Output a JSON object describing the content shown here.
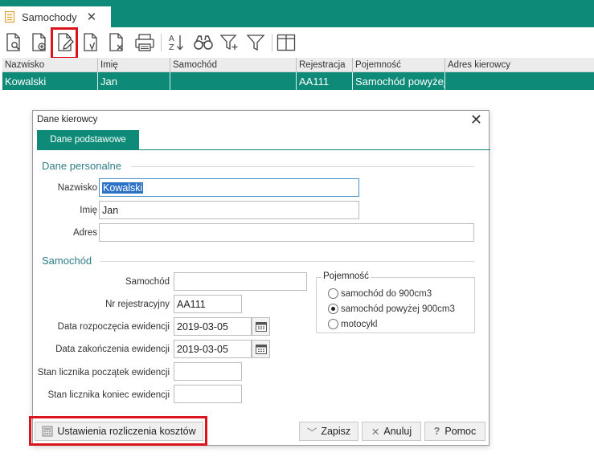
{
  "tab": {
    "title": "Samochody",
    "icon": "document-list-icon",
    "close_glyph": "✕"
  },
  "toolbar": {
    "buttons": [
      {
        "name": "preview-document-icon"
      },
      {
        "name": "add-document-icon"
      },
      {
        "name": "edit-document-icon",
        "highlighted": true
      },
      {
        "name": "approve-document-icon"
      },
      {
        "name": "delete-document-icon"
      },
      {
        "name": "print-icon"
      },
      {
        "name": "sort-az-icon"
      },
      {
        "name": "binoculars-icon"
      },
      {
        "name": "filter-add-icon"
      },
      {
        "name": "filter-icon"
      },
      {
        "name": "columns-icon"
      }
    ]
  },
  "grid": {
    "columns": [
      "Nazwisko",
      "Imię",
      "Samochód",
      "Rejestracja",
      "Pojemność",
      "Adres kierowcy"
    ],
    "rows": [
      [
        "Kowalski",
        "Jan",
        "",
        "AA111",
        "Samochód powyżej",
        ""
      ]
    ]
  },
  "dialog": {
    "title": "Dane kierowcy",
    "close_glyph": "✕",
    "tab_label": "Dane podstawowe",
    "personal": {
      "section_title": "Dane personalne",
      "surname_label": "Nazwisko",
      "surname_value": "Kowalski",
      "name_label": "Imię",
      "name_value": "Jan",
      "address_label": "Adres",
      "address_value": ""
    },
    "car": {
      "section_title": "Samochód",
      "car_label": "Samochód",
      "car_value": "",
      "reg_label": "Nr rejestracyjny",
      "reg_value": "AA111",
      "start_date_label": "Data rozpoczęcia ewidencji",
      "start_date_value": "2019-03-05",
      "end_date_label": "Data zakończenia ewidencji",
      "end_date_value": "2019-03-05",
      "odo_start_label": "Stan licznika początek ewidencji",
      "odo_start_value": "",
      "odo_end_label": "Stan licznika koniec ewidencji",
      "odo_end_value": ""
    },
    "capacity": {
      "legend": "Pojemność",
      "options": [
        "samochód do 900cm3",
        "samochód powyżej 900cm3",
        "motocykl"
      ],
      "selected_index": 1
    },
    "buttons": {
      "settings_prefix": "",
      "settings_label": "Ustawienia rozliczenia kosztów",
      "save_label": "Zapisz",
      "cancel_label": "Anuluj",
      "help_label": "Pomoc"
    }
  },
  "colors": {
    "accent": "#0e8a78",
    "highlight": "#d9141e",
    "selection": "#2b72c6",
    "section_title": "#2f7d88"
  }
}
